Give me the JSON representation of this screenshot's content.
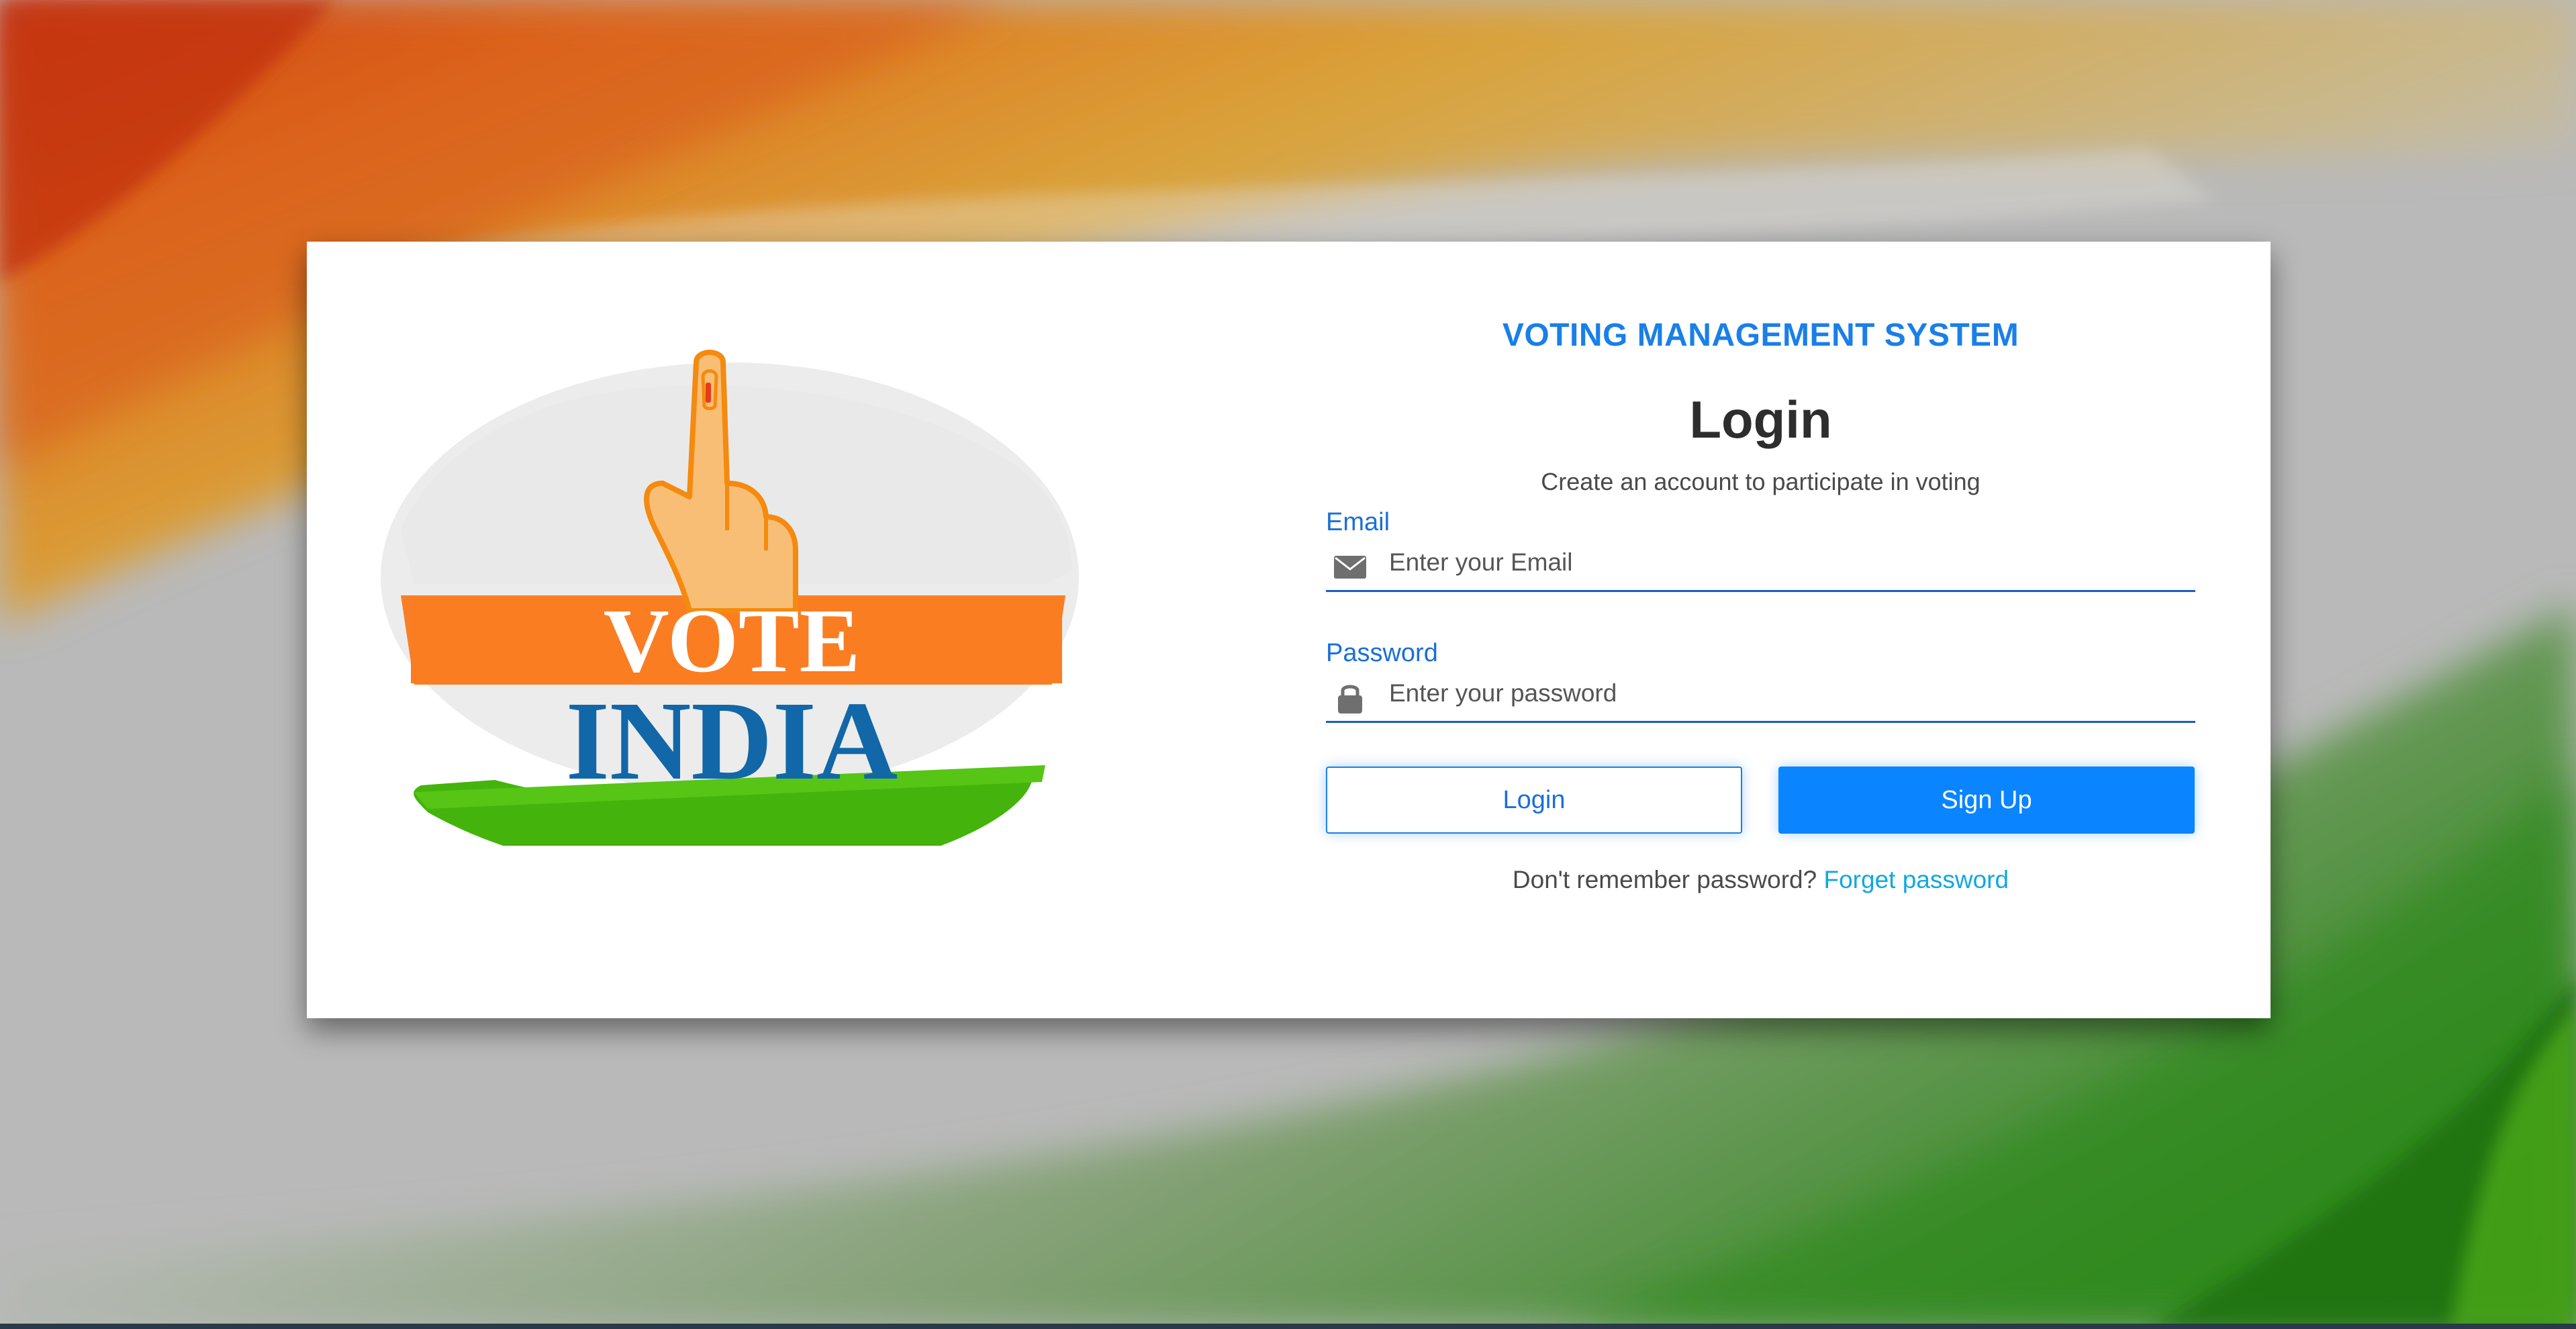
{
  "colors": {
    "accent": "#1a7fe8",
    "primary_button": "#0a84ff",
    "link": "#10a8e0",
    "saffron": "#f97f27",
    "india_blue": "#1167a8",
    "green": "#3bb10a"
  },
  "logo": {
    "line1": "VOTE",
    "line2": "INDIA"
  },
  "header": {
    "system_title": "VOTING MANAGEMENT SYSTEM",
    "page_title": "Login",
    "subtitle": "Create an account to participate in voting"
  },
  "form": {
    "email": {
      "label": "Email",
      "placeholder": "Enter your Email",
      "icon": "envelope-icon"
    },
    "password": {
      "label": "Password",
      "placeholder": "Enter your password",
      "icon": "lock-icon"
    }
  },
  "buttons": {
    "login_label": "Login",
    "signup_label": "Sign Up"
  },
  "footer": {
    "forgot_prompt": "Don't remember password?",
    "forgot_link": "Forget password"
  }
}
